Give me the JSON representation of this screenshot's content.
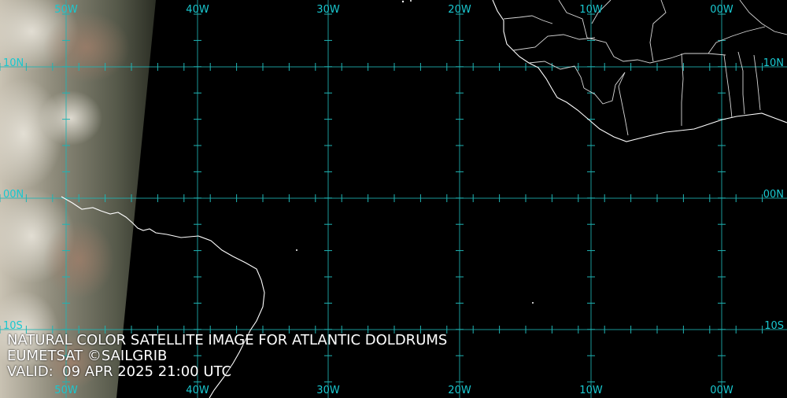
{
  "longitude_labels": [
    "50W",
    "40W",
    "30W",
    "20W",
    "10W",
    "00W"
  ],
  "latitude_labels": [
    "10N",
    "00N",
    "10S"
  ],
  "caption": {
    "title": "NATURAL COLOR SATELLITE IMAGE FOR ATLANTIC DOLDRUMS",
    "credit": "EUMETSAT ©SAILGRIB",
    "valid": "VALID:  09 APR 2025 21:00 UTC"
  },
  "colors": {
    "grid": "#1fb4b4",
    "label": "#19c8d0",
    "coastline": "#ffffff",
    "night_ocean": "#000000",
    "daylight_cloud": "#bfb59e"
  }
}
